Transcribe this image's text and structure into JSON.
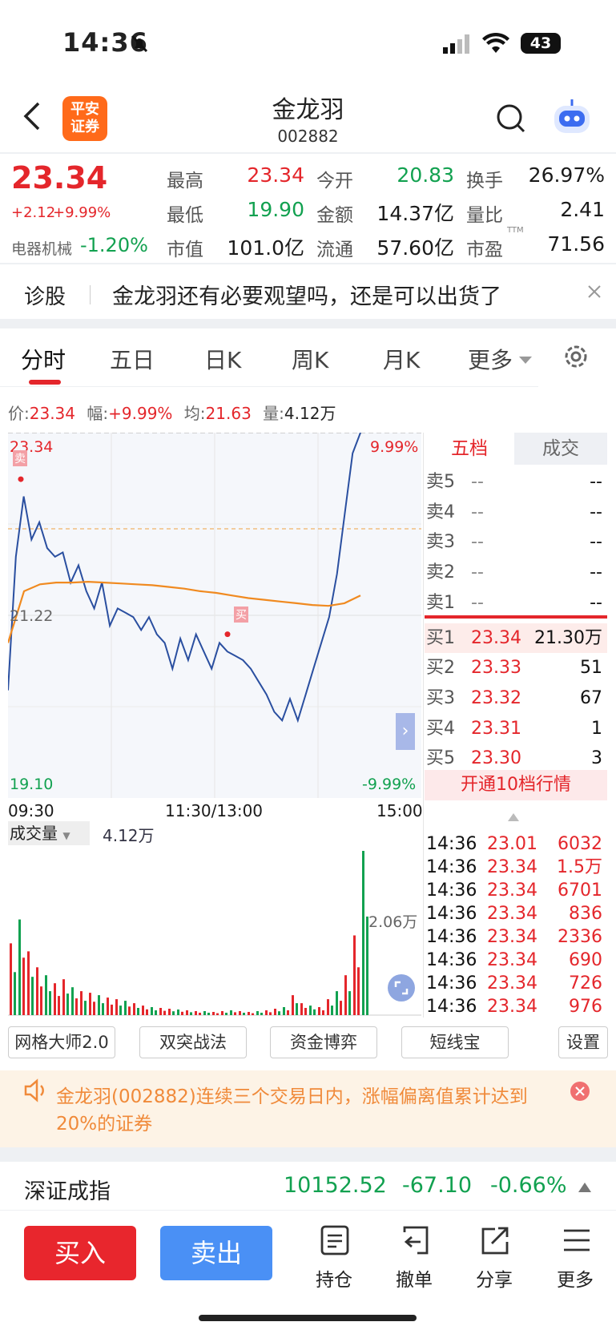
{
  "status_bar": {
    "time": "14:36",
    "battery": "43"
  },
  "header": {
    "title": "金龙羽",
    "code": "002882",
    "logo_line1": "平安",
    "logo_line2": "证券"
  },
  "quote": {
    "price": "23.34",
    "change": "+2.12",
    "change_pct": "+9.99%",
    "sector_name": "电器机械",
    "sector_change": "-1.20%",
    "fields": [
      {
        "label": "最高",
        "value": "23.34",
        "color": "red"
      },
      {
        "label": "今开",
        "value": "20.83",
        "color": "green"
      },
      {
        "label": "换手",
        "value": "26.97%",
        "color": "black"
      },
      {
        "label": "最低",
        "value": "19.90",
        "color": "green"
      },
      {
        "label": "金额",
        "value": "14.37亿",
        "color": "black"
      },
      {
        "label": "量比",
        "value": "2.41",
        "color": "black"
      },
      {
        "label": "市值",
        "value": "101.0亿",
        "color": "black"
      },
      {
        "label": "流通",
        "value": "57.60亿",
        "color": "black"
      },
      {
        "label": "市盈",
        "value": "71.56",
        "color": "black"
      }
    ],
    "ttm": "TTM"
  },
  "diagnosis": {
    "label": "诊股",
    "text": "金龙羽还有必要观望吗，还是可以出货了"
  },
  "tabs": [
    "分时",
    "五日",
    "日K",
    "周K",
    "月K",
    "更多"
  ],
  "info_line": {
    "price_label": "价:",
    "price": "23.34",
    "amp_label": "幅:",
    "amp": "+9.99%",
    "avg_label": "均:",
    "avg": "21.63",
    "vol_label": "量:",
    "vol": "4.12万"
  },
  "chart_labels": {
    "top_price": "23.34",
    "mid_price": "21.22",
    "low_price": "19.10",
    "top_pct": "9.99%",
    "low_pct": "-9.99%",
    "t_start": "09:30",
    "t_mid": "11:30/13:00",
    "t_end": "15:00",
    "buy_marker": "买",
    "vol_title": "成交量",
    "vol_value": "4.12万",
    "vol_max": "2.06万"
  },
  "chart_data": {
    "type": "line",
    "x_range": [
      "09:30",
      "15:00"
    ],
    "ylim": [
      19.1,
      23.34
    ],
    "reference_price": 21.22,
    "series": [
      {
        "values": [
          20.35,
          21.9,
          22.6,
          22.1,
          22.3,
          22.0,
          21.9,
          21.95,
          21.6,
          21.8,
          21.5,
          21.3,
          21.6,
          21.1,
          21.3,
          21.25,
          21.2,
          21.05,
          21.2,
          21.0,
          20.9,
          20.6,
          20.95,
          20.7,
          21.0,
          20.8,
          20.6,
          20.9,
          20.8,
          20.75,
          20.7,
          20.6,
          20.45,
          20.3,
          20.1,
          20.0,
          20.25,
          20.0,
          20.3,
          20.6,
          20.9,
          21.2,
          21.7,
          22.4,
          23.1,
          23.34
        ]
      },
      {
        "values": [
          20.9,
          21.5,
          21.58,
          21.6,
          21.6,
          21.61,
          21.6,
          21.59,
          21.58,
          21.57,
          21.55,
          21.53,
          21.5,
          21.48,
          21.45,
          21.42,
          21.4,
          21.38,
          21.36,
          21.34,
          21.33,
          21.36,
          21.45
        ]
      }
    ],
    "volume": {
      "max_label": "2.06万",
      "values": [
        0.9,
        1.2,
        0.8,
        0.6,
        0.5,
        0.4,
        0.45,
        0.35,
        0.3,
        0.28,
        0.25,
        0.22,
        0.2,
        0.18,
        0.15,
        0.12,
        0.1,
        0.09,
        0.08,
        0.07,
        0.06,
        0.05,
        0.05,
        0.04,
        0.05,
        0.06,
        0.05,
        0.04,
        0.05,
        0.06,
        0.08,
        0.1,
        0.25,
        0.15,
        0.12,
        0.1,
        0.2,
        0.3,
        0.5,
        1.0,
        2.06
      ]
    }
  },
  "orderbook": {
    "tab_active": "五档",
    "tab_other": "成交",
    "asks": [
      {
        "label": "卖5",
        "price": "--",
        "vol": "--"
      },
      {
        "label": "卖4",
        "price": "--",
        "vol": "--"
      },
      {
        "label": "卖3",
        "price": "--",
        "vol": "--"
      },
      {
        "label": "卖2",
        "price": "--",
        "vol": "--"
      },
      {
        "label": "卖1",
        "price": "--",
        "vol": "--"
      }
    ],
    "bids": [
      {
        "label": "买1",
        "price": "23.34",
        "vol": "21.30万"
      },
      {
        "label": "买2",
        "price": "23.33",
        "vol": "51"
      },
      {
        "label": "买3",
        "price": "23.32",
        "vol": "67"
      },
      {
        "label": "买4",
        "price": "23.31",
        "vol": "1"
      },
      {
        "label": "买5",
        "price": "23.30",
        "vol": "3"
      }
    ],
    "open10": "开通10档行情"
  },
  "trades": [
    {
      "time": "14:36",
      "price": "23.01",
      "vol": "6032"
    },
    {
      "time": "14:36",
      "price": "23.34",
      "vol": "1.5万"
    },
    {
      "time": "14:36",
      "price": "23.34",
      "vol": "6701"
    },
    {
      "time": "14:36",
      "price": "23.34",
      "vol": "836"
    },
    {
      "time": "14:36",
      "price": "23.34",
      "vol": "2336"
    },
    {
      "time": "14:36",
      "price": "23.34",
      "vol": "690"
    },
    {
      "time": "14:36",
      "price": "23.34",
      "vol": "726"
    },
    {
      "time": "14:36",
      "price": "23.34",
      "vol": "976"
    }
  ],
  "tools": [
    "网格大师2.0",
    "双突战法",
    "资金博弈",
    "短线宝",
    "设置"
  ],
  "notice": "金龙羽(002882)连续三个交易日内，涨幅偏离值累计达到20%的证券",
  "index_bar": {
    "name": "深证成指",
    "value": "10152.52",
    "change": "-67.10",
    "pct": "-0.66%"
  },
  "bottom": {
    "buy": "买入",
    "sell": "卖出",
    "hold": "持仓",
    "cancel": "撤单",
    "share": "分享",
    "more": "更多"
  }
}
